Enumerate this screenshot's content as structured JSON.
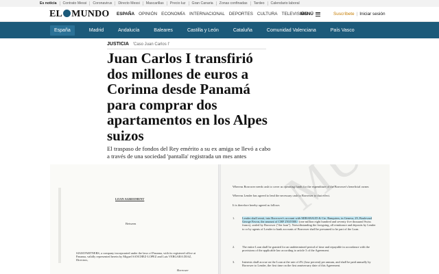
{
  "topbar": {
    "lead": "Es noticia",
    "items": [
      "Contrato Messi",
      "Coronavirus",
      "Directo Messi",
      "Mascarillas",
      "Precio luz",
      "Gran Canaria",
      "Zonas confinadas",
      "Tardeo",
      "Calendario laboral"
    ]
  },
  "header": {
    "logo_left": "EL",
    "logo_right": "MUNDO",
    "nav": [
      "ESPAÑA",
      "OPINIÓN",
      "ECONOMÍA",
      "INTERNACIONAL",
      "DEPORTES",
      "CULTURA",
      "TELEVISIÓN"
    ],
    "menu_label": "MENÚ",
    "subscribe": "Suscríbete",
    "login": "Iniciar sesión"
  },
  "regions": [
    "España",
    "Madrid",
    "Andalucía",
    "Baleares",
    "Castilla y León",
    "Cataluña",
    "Comunidad Valenciana",
    "País Vasco"
  ],
  "article": {
    "section": "JUSTICIA",
    "tag": "'Caso Juan Carlos I'",
    "headline": "Juan Carlos I transfirió dos millones de euros a Corinna desde Panamá para comprar dos apartamentos en los Alpes suizos",
    "subtitle": "El traspaso de fondos del Rey emérito a su ex amiga se llevó a cabo a través de una sociedad 'pantalla' registrada un mes antes"
  },
  "document": {
    "left_title": "LOAN AGREEMENT",
    "between": "Between",
    "party_name": "SIAM PARTNERS",
    "party_text": ", a company incorporated under the laws of Panama, with its registered office at Panama, validly represented herein by Miguel SANCHEZ-LOPEZ and Luis VERGARA DIAZ, Directors,",
    "borrower": "Borrower",
    "right_p1": "Whereas Borrower needs cash to cover as operating funds for the expenditure of the Borrower's beneficial owner.",
    "right_p2": "Whereas Lender has agreed to lend the necessary cash to Borrower to that effect.",
    "right_p3": "It is therefore hereby agreed as follows",
    "clause1_num": "1.",
    "clause1_hl": "Lender shall remit, into Borrower's account with MIRABAUD & Cie, Banquiers, in Geneva, 29, Boulevard George Favon, the amount of CHF 2'835'000.-",
    "clause1_rest": "(one million eight hundred and seventy five thousand Swiss francs), sealed by Borrower (\"the loan\"). Notwithstanding the foregoing, all remittance and deposits by Lender to or by agents of Lender to bank accounts of Borrower shall be presumed to be part of the Loan.",
    "clause2_num": "2.",
    "clause2": "The entire Loan shall be granted for an undetermined period of time and repayable in accordance with the provisions of the applicable law according to article 3 of the Agreement.",
    "clause3_num": "3.",
    "clause3": "Interests shall accrue on the Loan at the rate of 4% (four percent) per annum, and shall be paid annually by Borrower to Lender, the first time on the first anniversary date of this Agreement.",
    "watermark": "MUNDO"
  },
  "colors": {
    "brand_blue": "#1c5a7a",
    "subscribe_orange": "#c57b00",
    "highlight": "#bfe6f2"
  }
}
